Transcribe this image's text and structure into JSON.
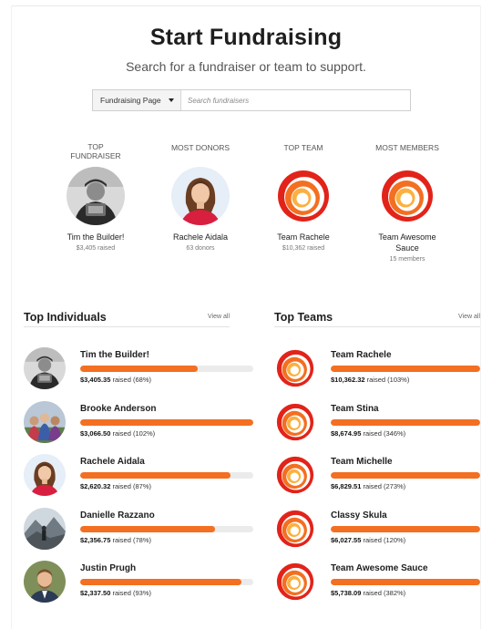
{
  "header": {
    "title": "Start Fundraising",
    "subtitle": "Search for a fundraiser or team to support."
  },
  "search": {
    "select_value": "Fundraising Page",
    "placeholder": "Search fundraisers"
  },
  "featured": [
    {
      "category": "TOP FUNDRAISER",
      "name": "Tim the Builder!",
      "meta": "$3,405 raised",
      "kind": "person-builder"
    },
    {
      "category": "MOST DONORS",
      "name": "Rachele Aidala",
      "meta": "63 donors",
      "kind": "person-woman"
    },
    {
      "category": "TOP TEAM",
      "name": "Team Rachele",
      "meta": "$10,362 raised",
      "kind": "team-logo"
    },
    {
      "category": "MOST MEMBERS",
      "name": "Team Awesome Sauce",
      "meta": "15 members",
      "kind": "team-logo"
    }
  ],
  "top_individuals": {
    "title": "Top Individuals",
    "view_all": "View all",
    "rows": [
      {
        "name": "Tim the Builder!",
        "amount": "$3,405.35",
        "raised_suffix": "raised (68%)",
        "progress": 0.68,
        "kind": "person-builder"
      },
      {
        "name": "Brooke Anderson",
        "amount": "$3,066.50",
        "raised_suffix": "raised (102%)",
        "progress": 1.0,
        "kind": "person-group"
      },
      {
        "name": "Rachele Aidala",
        "amount": "$2,620.32",
        "raised_suffix": "raised (87%)",
        "progress": 0.87,
        "kind": "person-woman"
      },
      {
        "name": "Danielle Razzano",
        "amount": "$2,356.75",
        "raised_suffix": "raised (78%)",
        "progress": 0.78,
        "kind": "person-mountain"
      },
      {
        "name": "Justin Prugh",
        "amount": "$2,337.50",
        "raised_suffix": "raised (93%)",
        "progress": 0.93,
        "kind": "person-man"
      }
    ]
  },
  "top_teams": {
    "title": "Top Teams",
    "view_all": "View all",
    "rows": [
      {
        "name": "Team Rachele",
        "amount": "$10,362.32",
        "raised_suffix": "raised (103%)",
        "progress": 1.0,
        "kind": "team-logo"
      },
      {
        "name": "Team Stina",
        "amount": "$8,674.95",
        "raised_suffix": "raised (346%)",
        "progress": 1.0,
        "kind": "team-logo"
      },
      {
        "name": "Team Michelle",
        "amount": "$6,829.51",
        "raised_suffix": "raised (273%)",
        "progress": 1.0,
        "kind": "team-logo"
      },
      {
        "name": "Classy Skula",
        "amount": "$6,027.55",
        "raised_suffix": "raised (120%)",
        "progress": 1.0,
        "kind": "team-logo"
      },
      {
        "name": "Team Awesome Sauce",
        "amount": "$5,738.09",
        "raised_suffix": "raised (382%)",
        "progress": 1.0,
        "kind": "team-logo"
      }
    ]
  },
  "colors": {
    "accent": "#f36f21",
    "track": "#ebebeb",
    "logo_outer": "#e2231a",
    "logo_mid": "#f36f21",
    "logo_inner": "#fbb040"
  }
}
